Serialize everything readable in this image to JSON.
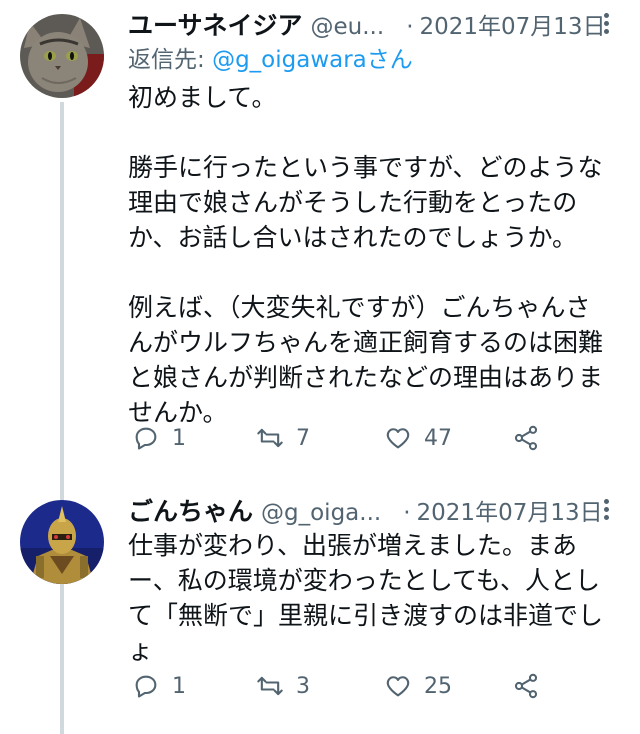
{
  "tweets": [
    {
      "display_name": "ユーサネイジア",
      "handle": "@eu...",
      "separator": "·",
      "date": "2021年07月13日",
      "reply_prefix": "返信先:",
      "reply_handle": "@g_oigawara",
      "reply_suffix": "さん",
      "body": [
        "初めまして。",
        "",
        "勝手に行ったという事ですが、どのような",
        "理由で娘さんがそうした行動をとったの",
        "か、お話し合いはされたのでしょうか。",
        "",
        "例えば、（大変失礼ですが）ごんちゃんさ",
        "んがウルフちゃんを適正飼育するのは困難",
        "と娘さんが判断されたなどの理由はありま",
        "せんか。"
      ],
      "replies": "1",
      "retweets": "7",
      "likes": "47"
    },
    {
      "display_name": "ごんちゃん",
      "handle": "@g_oiga...",
      "separator": "·",
      "date": "2021年07月13日",
      "body": [
        "仕事が変わり、出張が増えました。まあ",
        "ー、私の環境が変わったとしても、人とし",
        "て「無断で」里親に引き渡すのは非道でし",
        "ょ"
      ],
      "replies": "1",
      "retweets": "3",
      "likes": "25"
    }
  ],
  "icons": {
    "reply": "reply-icon",
    "retweet": "retweet-icon",
    "like": "heart-icon",
    "share": "share-icon",
    "more": "more-icon"
  },
  "colors": {
    "link": "#1d9bf0",
    "secondary": "#536471",
    "thread_line": "#cfd9de"
  }
}
